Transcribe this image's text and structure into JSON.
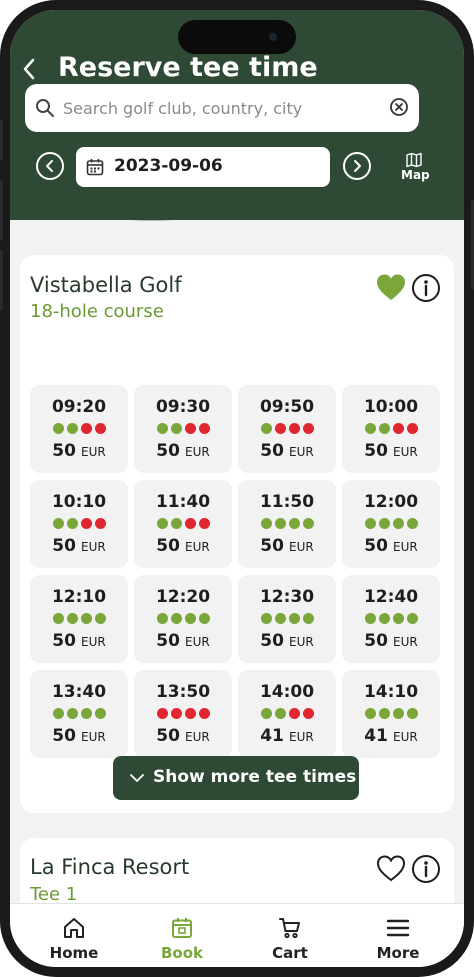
{
  "header": {
    "title": "Reserve tee time",
    "search_placeholder": "Search golf club, country, city",
    "date": "2023-09-06",
    "map_label": "Map"
  },
  "colors": {
    "header_bg": "#2f4a34",
    "accent_green": "#7aa63a",
    "availability_free": "#7aa63a",
    "availability_booked": "#e0262e"
  },
  "clubs": [
    {
      "name": "Vistabella Golf",
      "subtitle": "18-hole course",
      "favorite": true,
      "show_more_label": "Show more tee times",
      "slots": [
        {
          "time": "09:20",
          "availability": [
            "free",
            "free",
            "booked",
            "booked"
          ],
          "price": "50",
          "currency": "EUR"
        },
        {
          "time": "09:30",
          "availability": [
            "free",
            "free",
            "booked",
            "booked"
          ],
          "price": "50",
          "currency": "EUR"
        },
        {
          "time": "09:50",
          "availability": [
            "free",
            "booked",
            "booked",
            "booked"
          ],
          "price": "50",
          "currency": "EUR"
        },
        {
          "time": "10:00",
          "availability": [
            "free",
            "free",
            "booked",
            "booked"
          ],
          "price": "50",
          "currency": "EUR"
        },
        {
          "time": "10:10",
          "availability": [
            "free",
            "free",
            "booked",
            "booked"
          ],
          "price": "50",
          "currency": "EUR"
        },
        {
          "time": "11:40",
          "availability": [
            "free",
            "free",
            "booked",
            "booked"
          ],
          "price": "50",
          "currency": "EUR"
        },
        {
          "time": "11:50",
          "availability": [
            "free",
            "free",
            "free",
            "free"
          ],
          "price": "50",
          "currency": "EUR"
        },
        {
          "time": "12:00",
          "availability": [
            "free",
            "free",
            "free",
            "free"
          ],
          "price": "50",
          "currency": "EUR"
        },
        {
          "time": "12:10",
          "availability": [
            "free",
            "free",
            "free",
            "free"
          ],
          "price": "50",
          "currency": "EUR"
        },
        {
          "time": "12:20",
          "availability": [
            "free",
            "free",
            "free",
            "free"
          ],
          "price": "50",
          "currency": "EUR"
        },
        {
          "time": "12:30",
          "availability": [
            "free",
            "free",
            "free",
            "free"
          ],
          "price": "50",
          "currency": "EUR"
        },
        {
          "time": "12:40",
          "availability": [
            "free",
            "free",
            "free",
            "free"
          ],
          "price": "50",
          "currency": "EUR"
        },
        {
          "time": "13:40",
          "availability": [
            "free",
            "free",
            "free",
            "free"
          ],
          "price": "50",
          "currency": "EUR"
        },
        {
          "time": "13:50",
          "availability": [
            "booked",
            "booked",
            "booked",
            "booked"
          ],
          "price": "50",
          "currency": "EUR"
        },
        {
          "time": "14:00",
          "availability": [
            "free",
            "free",
            "booked",
            "booked"
          ],
          "price": "41",
          "currency": "EUR"
        },
        {
          "time": "14:10",
          "availability": [
            "free",
            "free",
            "free",
            "free"
          ],
          "price": "41",
          "currency": "EUR"
        }
      ]
    },
    {
      "name": "La Finca Resort",
      "subtitle": "Tee 1",
      "favorite": false
    }
  ],
  "tabs": [
    {
      "label": "Home",
      "icon": "home-icon",
      "active": false
    },
    {
      "label": "Book",
      "icon": "calendar-icon",
      "active": true
    },
    {
      "label": "Cart",
      "icon": "cart-icon",
      "active": false
    },
    {
      "label": "More",
      "icon": "menu-icon",
      "active": false
    }
  ]
}
